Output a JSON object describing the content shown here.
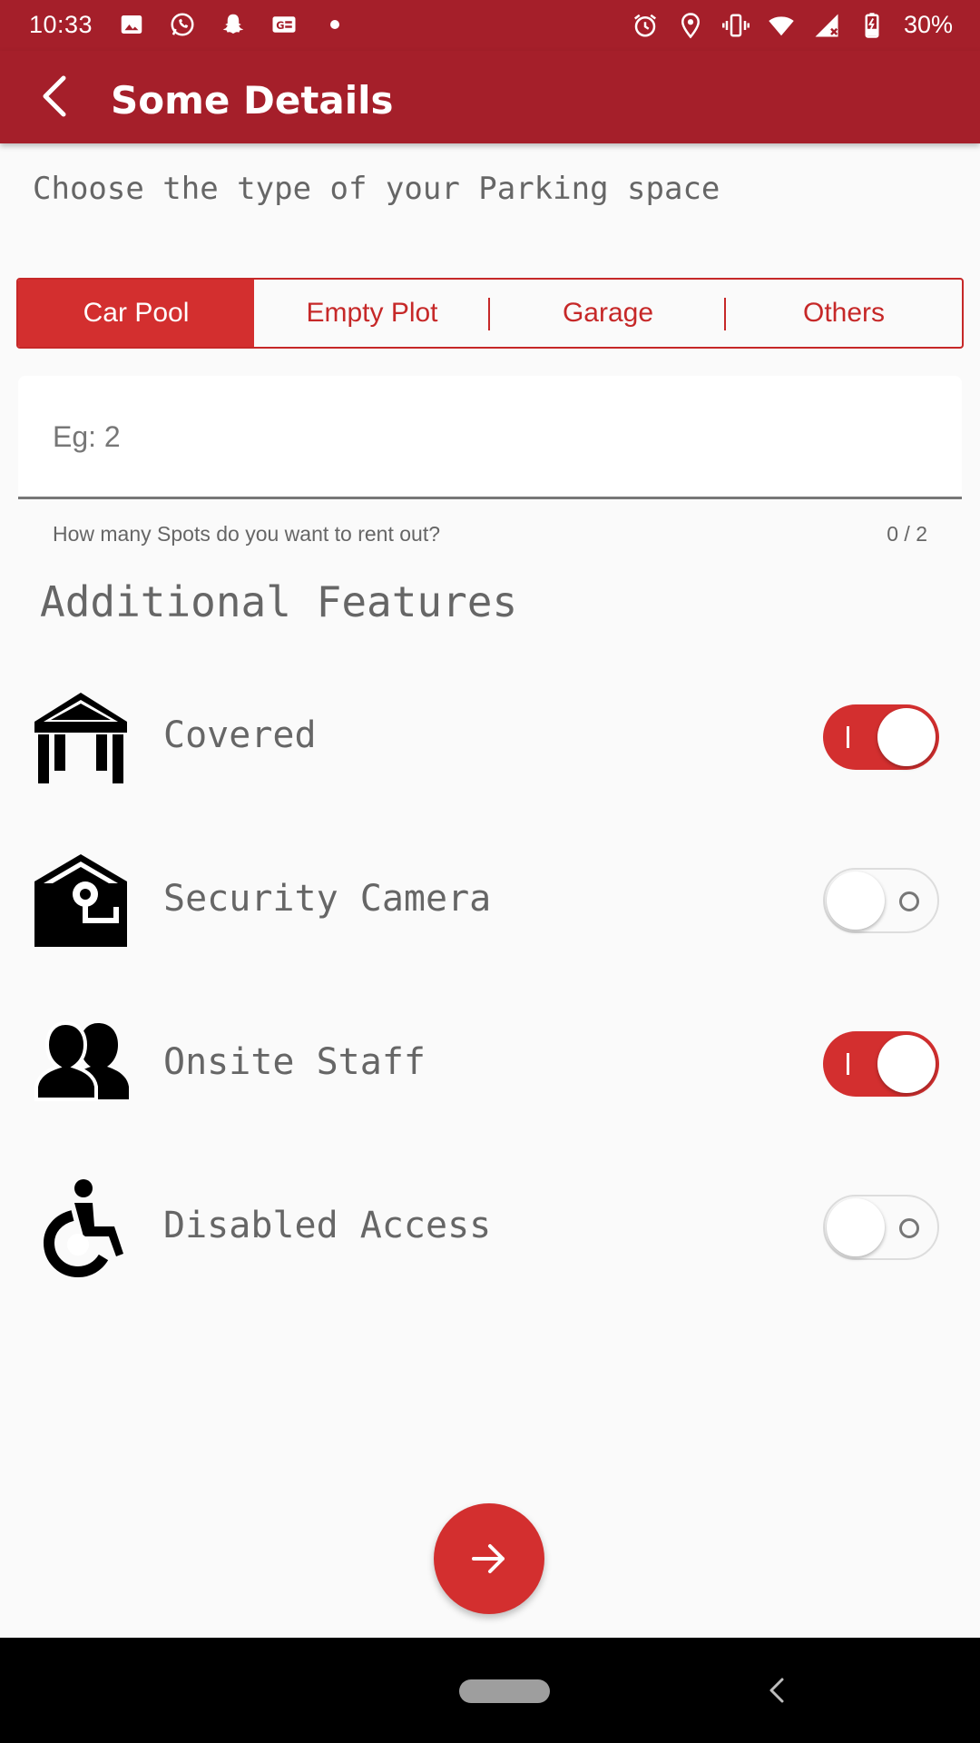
{
  "status_bar": {
    "time": "10:33",
    "battery": "30%",
    "left_icons": [
      "image-icon",
      "whatsapp-icon",
      "snapchat-icon",
      "news-icon",
      "dot-icon"
    ],
    "right_icons": [
      "alarm-icon",
      "location-icon",
      "vibrate-icon",
      "wifi-icon",
      "signal-icon",
      "battery-icon"
    ]
  },
  "appbar": {
    "title": "Some Details"
  },
  "parking_type": {
    "hint": "Choose the type of your Parking space",
    "options": [
      "Car Pool",
      "Empty Plot",
      "Garage",
      "Others"
    ],
    "selected": "Car Pool"
  },
  "spots_field": {
    "placeholder": "Eg: 2",
    "value": "",
    "helper": "How many Spots do you want to rent out?",
    "counter": "0 / 2"
  },
  "features": {
    "title": "Additional Features",
    "items": [
      {
        "label": "Covered",
        "icon": "covered-shelter-icon",
        "enabled": true
      },
      {
        "label": "Security Camera",
        "icon": "security-camera-icon",
        "enabled": false
      },
      {
        "label": "Onsite Staff",
        "icon": "staff-icon",
        "enabled": true
      },
      {
        "label": "Disabled Access",
        "icon": "wheelchair-icon",
        "enabled": false
      }
    ]
  },
  "colors": {
    "primary_dark": "#a51f2a",
    "accent": "#d32f2f",
    "background": "#fafafa"
  },
  "fab": {
    "icon": "arrow-right-icon"
  }
}
